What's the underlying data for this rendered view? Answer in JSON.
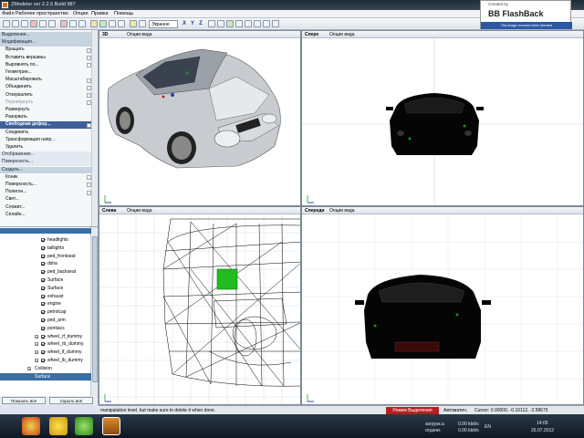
{
  "window": {
    "title": "ZModeler ver 2.2.5  Build 987"
  },
  "menu": [
    "Файл",
    "Рабочее пространство",
    "Опции",
    "Правка",
    "Помощь"
  ],
  "toolbar": {
    "view_select": "Экранне",
    "axes": [
      "X",
      "Y",
      "Z"
    ]
  },
  "flashback": {
    "created_by": "Created by",
    "name": "BB FlashBack",
    "strip": "This image removed when licensed"
  },
  "left_panel": [
    {
      "t": "Выделение...",
      "k": "head"
    },
    {
      "t": "Модификация...",
      "k": "head"
    },
    {
      "t": "Вращать",
      "k": "item",
      "box": true
    },
    {
      "t": "Вставить вершины",
      "k": "item",
      "box": true
    },
    {
      "t": "Выровнять по...",
      "k": "item",
      "box": true
    },
    {
      "t": "Геометрия...",
      "k": "item"
    },
    {
      "t": "Масштабировать",
      "k": "item",
      "box": true
    },
    {
      "t": "Объединить",
      "k": "item",
      "box": true
    },
    {
      "t": "Отзеркалить",
      "k": "item",
      "box": true
    },
    {
      "t": "Перевёрнуть",
      "k": "item dis",
      "box": true
    },
    {
      "t": "Развернуть",
      "k": "item"
    },
    {
      "t": "Разорвать",
      "k": "item"
    },
    {
      "t": "Свободная дефор...",
      "k": "item sel",
      "box": true
    },
    {
      "t": "Соединить",
      "k": "item"
    },
    {
      "t": "Трансформация напр...",
      "k": "item"
    },
    {
      "t": "Удалить",
      "k": "item"
    },
    {
      "t": "Отображение...",
      "k": "head2"
    },
    {
      "t": "Поверхность...",
      "k": "head2"
    },
    {
      "t": "Создать...",
      "k": "head"
    },
    {
      "t": "Коник",
      "k": "item",
      "box": true
    },
    {
      "t": "Поверхность...",
      "k": "item",
      "box": true
    },
    {
      "t": "Полигон...",
      "k": "item",
      "box": true
    },
    {
      "t": "Свет...",
      "k": "item"
    },
    {
      "t": "Сложит...",
      "k": "item"
    },
    {
      "t": "Сплайн...",
      "k": "item"
    }
  ],
  "tree": [
    {
      "t": "headlights"
    },
    {
      "t": "taillights"
    },
    {
      "t": "ped_frontseat"
    },
    {
      "t": "dsha"
    },
    {
      "t": "ped_backseat"
    },
    {
      "t": "Surface"
    },
    {
      "t": "Surface"
    },
    {
      "t": "exhaust"
    },
    {
      "t": "engine"
    },
    {
      "t": "petrolcap"
    },
    {
      "t": "ped_arm"
    },
    {
      "t": "pontiacs"
    },
    {
      "t": "wheel_rf_dummy",
      "plus": true
    },
    {
      "t": "wheel_rb_dummy",
      "plus": true
    },
    {
      "t": "wheel_lf_dummy",
      "plus": true
    },
    {
      "t": "wheel_lb_dummy",
      "plus": true
    },
    {
      "t": "Collision",
      "plus": true,
      "nocb": true
    },
    {
      "t": "Surface",
      "sel": true,
      "nocb": true
    }
  ],
  "tree_buttons": {
    "left": "Показать всё",
    "right": "Скрыть всё"
  },
  "viewports": [
    {
      "id": "3d",
      "name": "3D",
      "options": "Опции вида"
    },
    {
      "id": "front",
      "name": "Спере",
      "options": "Опции вида"
    },
    {
      "id": "left",
      "name": "Слева",
      "options": "Опции вида"
    },
    {
      "id": "back",
      "name": "Спереди",
      "options": "Опции вида"
    }
  ],
  "status": {
    "message": "manipulation level, but make sure to delete it when done.",
    "mode": "Режим Выделения",
    "auto": "Автоматич.",
    "cursor": "Cursor: 0.00000, -0.10112, -2.58675"
  },
  "tray": {
    "load": "загрузк.а",
    "send": "отдачи:",
    "rate1": "0.00 kbit/s",
    "rate2": "0.00 kbit/s",
    "lang": "EN",
    "time": "14:05",
    "date": "26.07.2012"
  },
  "colors": {
    "selection": "#3f5f9a",
    "mode_bg": "#b42020",
    "grid": "#c9d6e2"
  }
}
